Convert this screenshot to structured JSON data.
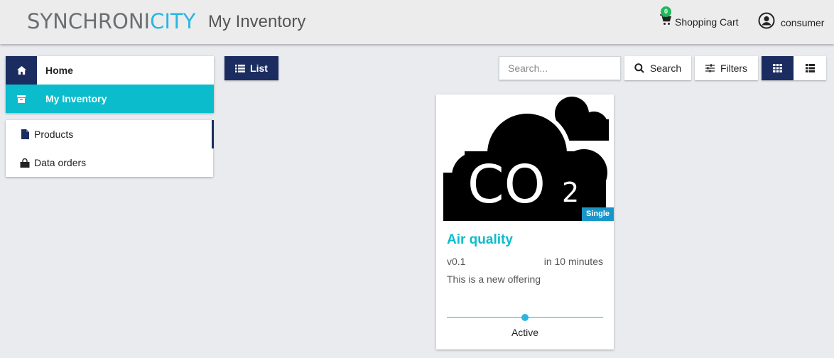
{
  "header": {
    "logo_part1": "SYNCHRONI",
    "logo_part2": "CITY",
    "page_title": "My Inventory",
    "cart_count": "0",
    "cart_label": "Shopping Cart",
    "user_label": "consumer"
  },
  "sidebar": {
    "items": [
      {
        "label": "Home",
        "icon": "home-icon"
      },
      {
        "label": "My Inventory",
        "icon": "archive-icon",
        "active": true
      }
    ],
    "sub_items": [
      {
        "label": "Products",
        "icon": "file-icon",
        "active": true
      },
      {
        "label": "Data orders",
        "icon": "shopping-bag-icon"
      }
    ]
  },
  "toolbar": {
    "list_label": "List",
    "search_placeholder": "Search...",
    "search_value": "",
    "search_label": "Search",
    "filters_label": "Filters",
    "view_mode": "grid"
  },
  "card": {
    "image_text_main": "CO",
    "image_text_sub": "2",
    "badge": "Single",
    "title": "Air quality",
    "version": "v0.1",
    "time": "in 10 minutes",
    "description": "This is a new offering",
    "status": "Active"
  },
  "colors": {
    "navy": "#1b2d60",
    "teal": "#0bbccc",
    "logo_blue": "#29b6e0",
    "badge_blue": "#1996c9",
    "cart_badge_green": "#1fb85a"
  }
}
